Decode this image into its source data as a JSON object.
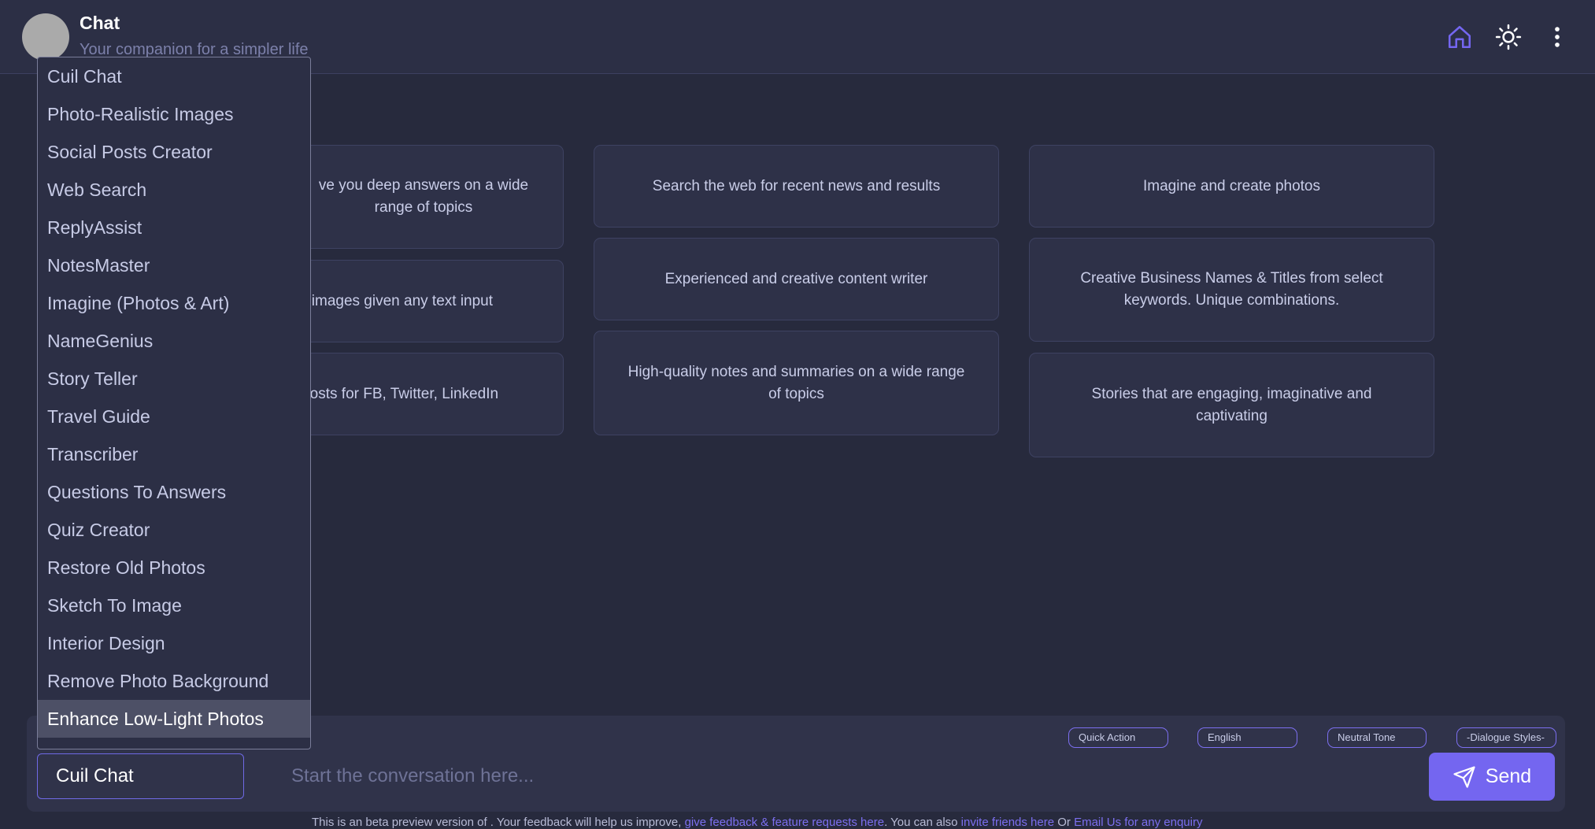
{
  "header": {
    "title": "Chat",
    "subtitle": "Your companion for a simpler life"
  },
  "colors": {
    "accent": "#7466f0",
    "background": "#272a3d",
    "card": "#2e3148"
  },
  "header_icons": [
    "home-icon",
    "sun-icon",
    "more-vertical-icon"
  ],
  "cards": [
    "ve you deep answers on a wide range of topics",
    "Search the web for recent news and results",
    "Imagine and create photos",
    "c images given any text input",
    "Experienced and creative content writer",
    "Creative Business Names & Titles from select keywords. Unique combinations.",
    "Posts for FB, Twitter, LinkedIn",
    "High-quality notes and summaries on a wide range of topics",
    "Stories that are engaging, imaginative and captivating"
  ],
  "dropdown": {
    "items": [
      "Cuil Chat",
      "Photo-Realistic Images",
      "Social Posts Creator",
      "Web Search",
      "ReplyAssist",
      "NotesMaster",
      "Imagine (Photos & Art)",
      "NameGenius",
      "Story Teller",
      "Travel Guide",
      "Transcriber",
      "Questions To Answers",
      "Quiz Creator",
      "Restore Old Photos",
      "Sketch To Image",
      "Interior Design",
      "Remove Photo Background",
      "Enhance Low-Light Photos"
    ],
    "highlighted": "Enhance Low-Light Photos"
  },
  "composer": {
    "chips": [
      "Quick Action",
      "English",
      "Neutral Tone",
      "-Dialogue Styles-"
    ],
    "model_value": "Cuil Chat",
    "placeholder": "Start the conversation here...",
    "send_label": "Send"
  },
  "footer": {
    "text1": "This is an beta preview version of . Your feedback will help us improve, ",
    "link1": "give feedback & feature requests here",
    "text2": ". You can also ",
    "link2": "invite friends here",
    "text3": " Or ",
    "link3": "Email Us for any enquiry"
  }
}
